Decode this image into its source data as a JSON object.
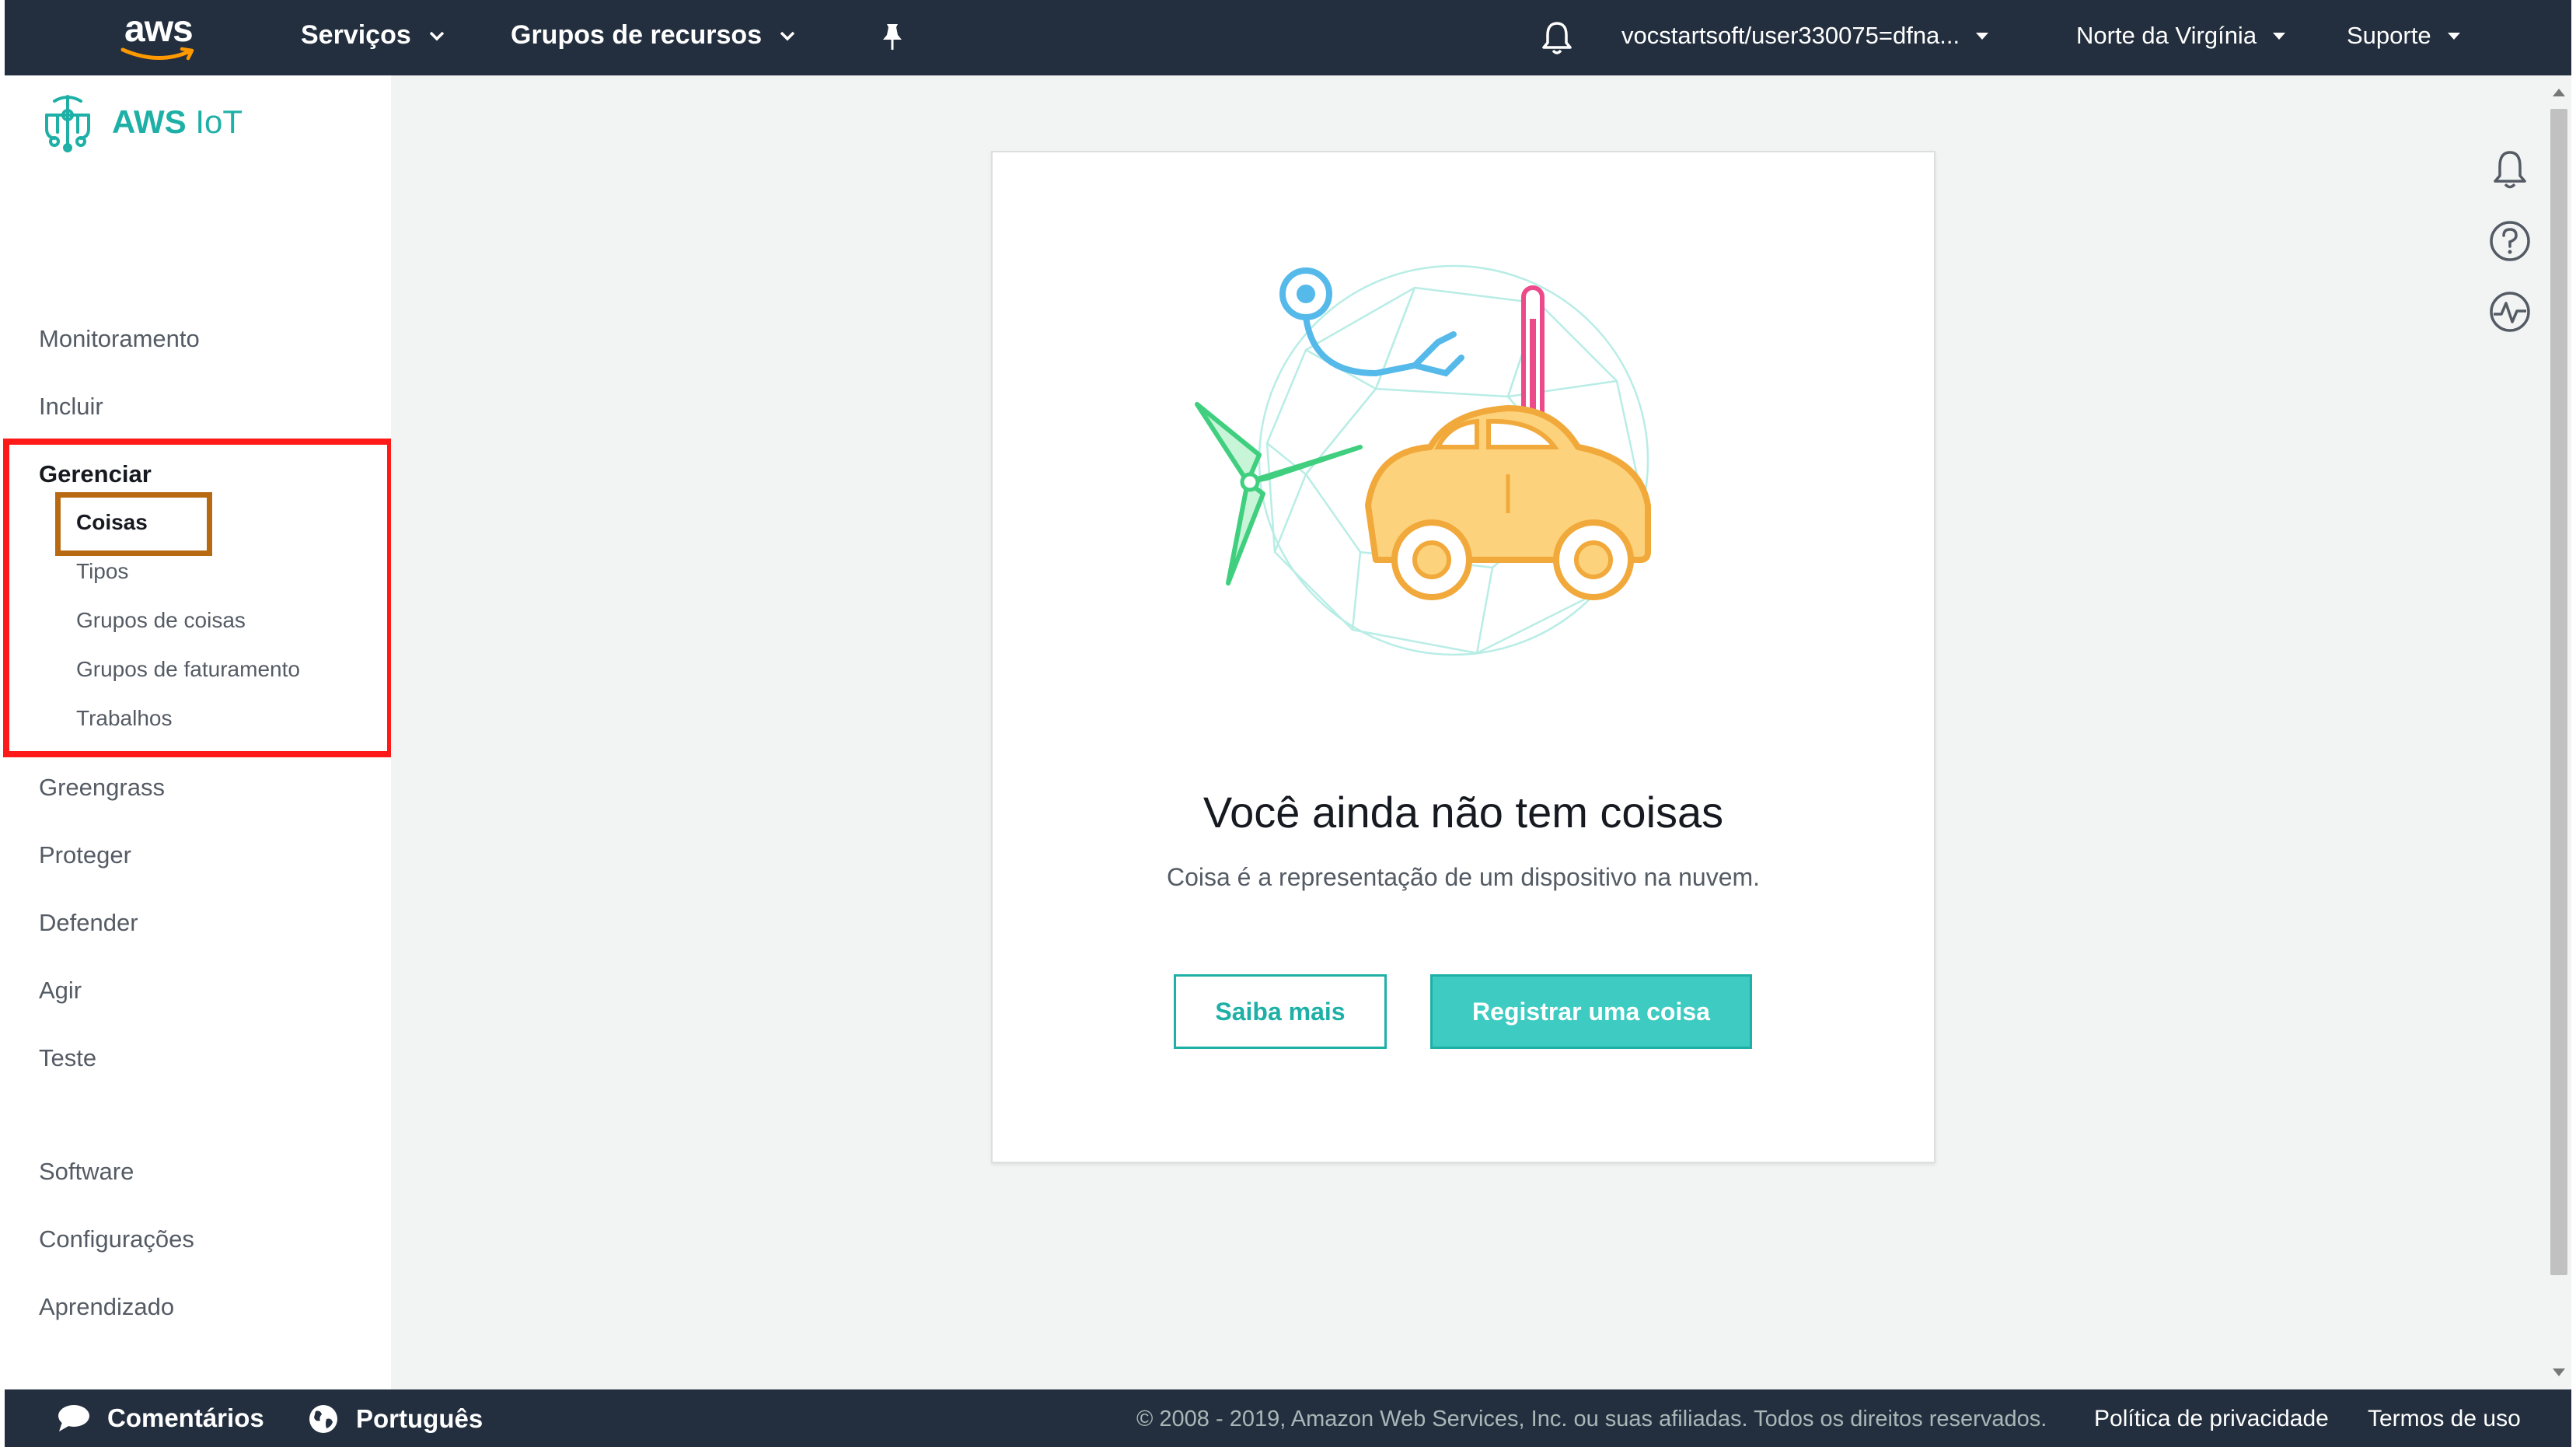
{
  "topnav": {
    "logo_text": "aws",
    "services_label": "Serviços",
    "resource_groups_label": "Grupos de recursos",
    "account_label": "vocstartsoft/user330075=dfna...",
    "region_label": "Norte da Virgínia",
    "support_label": "Suporte"
  },
  "sidebar": {
    "brand": "AWS",
    "brand_suffix": "IoT",
    "items_top": [
      {
        "label": "Monitoramento"
      },
      {
        "label": "Incluir"
      }
    ],
    "section": {
      "label": "Gerenciar",
      "sub_items": [
        {
          "label": "Coisas",
          "active": true
        },
        {
          "label": "Tipos"
        },
        {
          "label": "Grupos de coisas"
        },
        {
          "label": "Grupos de faturamento"
        },
        {
          "label": "Trabalhos"
        }
      ]
    },
    "items_mid": [
      {
        "label": "Greengrass"
      },
      {
        "label": "Proteger"
      },
      {
        "label": "Defender"
      },
      {
        "label": "Agir"
      },
      {
        "label": "Teste"
      }
    ],
    "items_bottom": [
      {
        "label": "Software"
      },
      {
        "label": "Configurações"
      },
      {
        "label": "Aprendizado"
      }
    ]
  },
  "main": {
    "empty_title": "Você ainda não tem coisas",
    "empty_subtitle": "Coisa é a representação de um dispositivo na nuvem.",
    "learn_more_label": "Saiba mais",
    "register_label": "Registrar uma coisa"
  },
  "footer": {
    "feedback_label": "Comentários",
    "language_label": "Português",
    "copyright": "© 2008 - 2019, Amazon Web Services, Inc. ou suas afiliadas. Todos os direitos reservados.",
    "privacy_label": "Política de privacidade",
    "terms_label": "Termos de uso"
  },
  "colors": {
    "nav_bg": "#232f3e",
    "accent_teal": "#1eb0a6",
    "primary_button": "#3ecbc1",
    "highlight_red": "#ff1a1a",
    "highlight_brown": "#b86a12"
  },
  "icons": {
    "pin": "pin-icon",
    "notifications": "bell-icon",
    "help": "help-icon",
    "activity": "activity-icon",
    "feedback": "speech-bubble-icon",
    "language": "globe-icon"
  }
}
